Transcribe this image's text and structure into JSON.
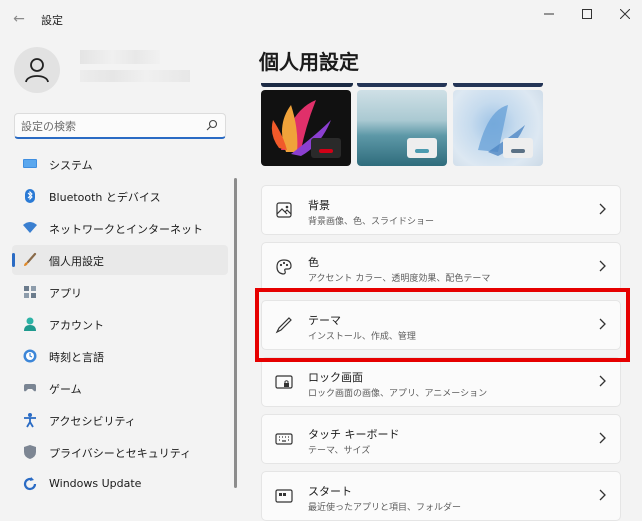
{
  "window": {
    "title": "設定",
    "back_icon": "back-arrow-icon",
    "controls": [
      "minimize-icon",
      "maximize-icon",
      "close-icon"
    ]
  },
  "search": {
    "placeholder": "設定の検索"
  },
  "nav": {
    "items": [
      {
        "label": "システム",
        "icon": "monitor-icon"
      },
      {
        "label": "Bluetooth とデバイス",
        "icon": "bluetooth-icon"
      },
      {
        "label": "ネットワークとインターネット",
        "icon": "wifi-icon"
      },
      {
        "label": "個人用設定",
        "icon": "brush-icon",
        "active": true
      },
      {
        "label": "アプリ",
        "icon": "apps-icon"
      },
      {
        "label": "アカウント",
        "icon": "account-icon"
      },
      {
        "label": "時刻と言語",
        "icon": "globe-clock-icon"
      },
      {
        "label": "ゲーム",
        "icon": "gamepad-icon"
      },
      {
        "label": "アクセシビリティ",
        "icon": "accessibility-icon"
      },
      {
        "label": "プライバシーとセキュリティ",
        "icon": "shield-icon"
      },
      {
        "label": "Windows Update",
        "icon": "update-icon"
      }
    ]
  },
  "main": {
    "title": "個人用設定",
    "themes": [
      {
        "name": "dark-bloom",
        "accent": "#d10016"
      },
      {
        "name": "glow-lake",
        "accent": "#4b9bb0"
      },
      {
        "name": "bloom-light",
        "accent": "#5b7185"
      }
    ],
    "cards": [
      {
        "title": "背景",
        "subtitle": "背景画像、色、スライドショー",
        "icon": "image-icon"
      },
      {
        "title": "色",
        "subtitle": "アクセント カラー、透明度効果、配色テーマ",
        "icon": "palette-icon"
      },
      {
        "title": "テーマ",
        "subtitle": "インストール、作成、管理",
        "icon": "pen-icon"
      },
      {
        "title": "ロック画面",
        "subtitle": "ロック画面の画像、アプリ、アニメーション",
        "icon": "lock-screen-icon"
      },
      {
        "title": "タッチ キーボード",
        "subtitle": "テーマ、サイズ",
        "icon": "keyboard-icon"
      },
      {
        "title": "スタート",
        "subtitle": "最近使ったアプリと項目、フォルダー",
        "icon": "start-icon"
      }
    ]
  },
  "colors": {
    "accent": "#2a6bc4",
    "highlight": "#e60000"
  }
}
